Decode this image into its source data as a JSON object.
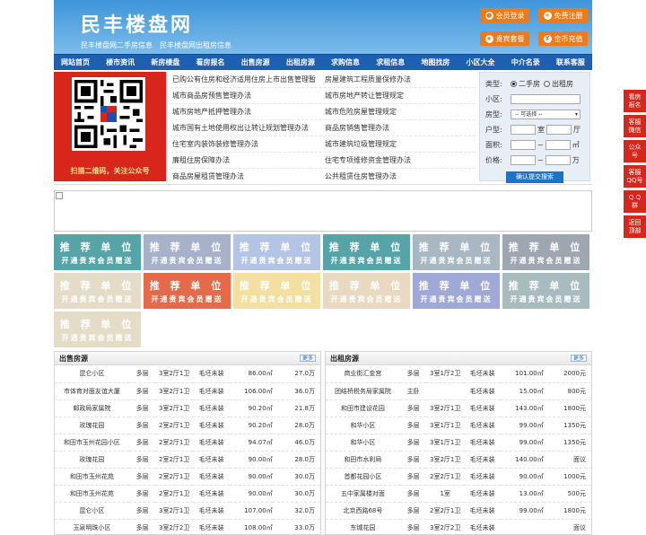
{
  "header": {
    "title": "民丰楼盘网",
    "subtitle": "民丰楼盘网二手房信息　民丰楼盘网出租房信息",
    "buttons": [
      {
        "label": "会员登录"
      },
      {
        "label": "免费注册"
      },
      {
        "label": "贵宾套餐"
      },
      {
        "label": "金币充值"
      }
    ]
  },
  "nav": [
    "网站首页",
    "楼市资讯",
    "新房楼盘",
    "看房报名",
    "出售房源",
    "出租房源",
    "求购信息",
    "求租信息",
    "地图找房",
    "小区大全",
    "中介名录",
    "联系客服"
  ],
  "qr": {
    "caption": "扫描二维码，关注公众号"
  },
  "news": [
    [
      "已购公有住房和经济适用住房上市出售管理暂",
      "房屋建筑工程质量保修办法"
    ],
    [
      "城市商品房预售管理办法",
      "城市房地产转让管理规定"
    ],
    [
      "城市房地产抵押管理办法",
      "城市危险房屋管理规定"
    ],
    [
      "城市国有土地使用权出让转让规划管理办法",
      "商品房销售管理办法"
    ],
    [
      "住宅室内装饰装修管理办法",
      "城市建筑垃圾管理规定"
    ],
    [
      "廉租住房保障办法",
      "住宅专项维修资金管理办法"
    ],
    [
      "商品房屋租赁管理办法",
      "公共租赁住房管理办法"
    ]
  ],
  "search": {
    "type_label": "类型:",
    "opt_sale": "二手房",
    "opt_rent": "出租房",
    "community_label": "小区:",
    "housetype_label": "房型:",
    "housetype_value": "-- 可选择 --",
    "layout_label": "户型:",
    "room_unit": "室",
    "hall_unit": "厅",
    "area_label": "面积:",
    "area_sep": "~",
    "area_unit": "㎡",
    "price_label": "价格:",
    "price_sep": "~",
    "price_unit": "万",
    "submit": "确认提交搜索"
  },
  "tiles": {
    "line1": "推 荐 单 位",
    "line2": "开通贵宾会员赠送",
    "colors": [
      "#56a3a8",
      "#a7b1c9",
      "#b4c4e5",
      "#56a3a8",
      "#a8b7c2",
      "#9ea7b1",
      "#e5dcc8",
      "#e46a4a",
      "#f3dfa0",
      "#e8d9c0",
      "#a0a8d8",
      "#a8bcc0",
      "#e5dcc8"
    ]
  },
  "sale": {
    "title": "出售房源",
    "more": "更多",
    "rows": [
      [
        "昆仑小区",
        "多层",
        "3室2厅1卫",
        "毛坯未装",
        "86.00㎡",
        "27.0万"
      ],
      [
        "市体育对面友谊大厦",
        "多层",
        "3室2厅1卫",
        "毛坯未装",
        "106.00㎡",
        "36.0万"
      ],
      [
        "邮政局家属院",
        "多层",
        "3室2厅1卫",
        "毛坯未装",
        "90.20㎡",
        "21.8万"
      ],
      [
        "玫瑰花园",
        "多层",
        "2室2厅1卫",
        "毛坯未装",
        "90.20㎡",
        "28.0万"
      ],
      [
        "和田市玉州花园小区",
        "多层",
        "2室2厅1卫",
        "毛坯未装",
        "94.07㎡",
        "46.0万"
      ],
      [
        "玫瑰花园",
        "多层",
        "2室2厅1卫",
        "毛坯未装",
        "90.00㎡",
        "28.0万"
      ],
      [
        "和田市玉州花苑",
        "多层",
        "2室2厅1卫",
        "毛坯未装",
        "90.00㎡",
        "30.0万"
      ],
      [
        "和田市玉州花苑",
        "多层",
        "2室2厅1卫",
        "毛坯未装",
        "90.00㎡",
        "30.0万"
      ],
      [
        "昆仑小区",
        "多层",
        "3室2厅1卫",
        "毛坯未装",
        "107.00㎡",
        "32.0万"
      ],
      [
        "玉泉明珠小区",
        "多层",
        "3室2厅2卫",
        "毛坯未装",
        "108.00㎡",
        "33.0万"
      ]
    ]
  },
  "rent": {
    "title": "出租房源",
    "more": "更多",
    "rows": [
      [
        "商业街汇金宫",
        "多层",
        "3室1厅2卫",
        "毛坯未装",
        "101.00㎡",
        "2000元"
      ],
      [
        "团结桥税务局家属院",
        "主卧",
        "",
        "毛坯未装",
        "15.00㎡",
        "800元"
      ],
      [
        "和田市建设花园",
        "多层",
        "3室2厅1卫",
        "毛坯未装",
        "143.00㎡",
        "1800元"
      ],
      [
        "和华小区",
        "多层",
        "3室1厅1卫",
        "毛坯未装",
        "99.00㎡",
        "1350元"
      ],
      [
        "和华小区",
        "多层",
        "3室1厅1卫",
        "毛坯未装",
        "99.00㎡",
        "1350元"
      ],
      [
        "和田市水利局",
        "多层",
        "3室2厅1卫",
        "毛坯未装",
        "140.00㎡",
        "面议"
      ],
      [
        "首都花园小区",
        "多层",
        "2室2厅1卫",
        "毛坯未装",
        "90.00㎡",
        "1000元"
      ],
      [
        "五中家属楼对面",
        "多层",
        "1室",
        "毛坯未装",
        "13.00㎡",
        "500元"
      ],
      [
        "北京西路68号",
        "多层",
        "2室2厅1卫",
        "毛坯未装",
        "99.00㎡",
        "1800元"
      ],
      [
        "东城花园",
        "多层",
        "3室2厅2卫",
        "毛坯未装",
        "",
        "面议"
      ]
    ]
  },
  "sidebar": [
    "看房\n报名",
    "客服\n微信",
    "公众\n号",
    "客服\nQQ号",
    "Q Q\n群",
    "返回\n顶部"
  ]
}
